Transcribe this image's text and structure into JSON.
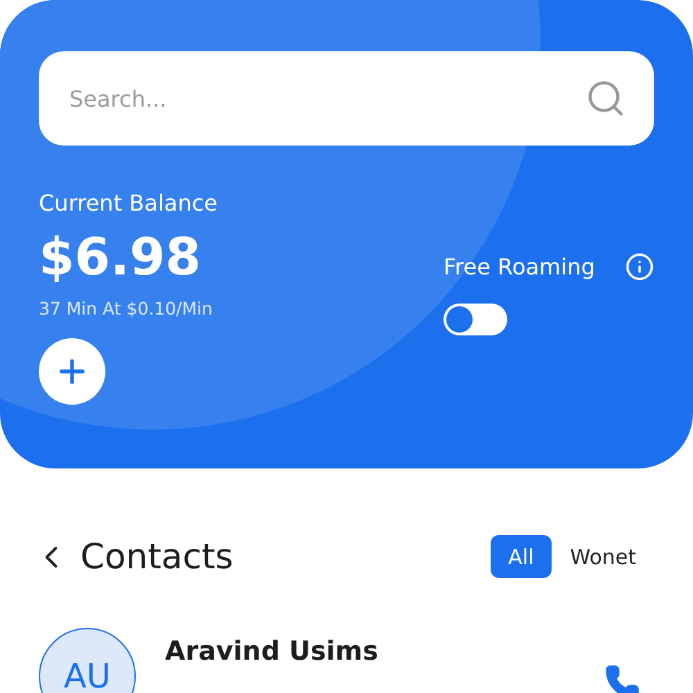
{
  "search": {
    "placeholder": "Search..."
  },
  "balance": {
    "label": "Current Balance",
    "amount": "$6.98",
    "rate": "37 Min At $0.10/Min"
  },
  "roaming": {
    "label": "Free Roaming",
    "on": false
  },
  "contacts": {
    "title": "Contacts",
    "filters": [
      {
        "label": "All",
        "selected": true
      },
      {
        "label": "Wonet",
        "selected": false
      }
    ],
    "items": [
      {
        "initials": "AU",
        "name": "Aravind Usims"
      }
    ]
  }
}
